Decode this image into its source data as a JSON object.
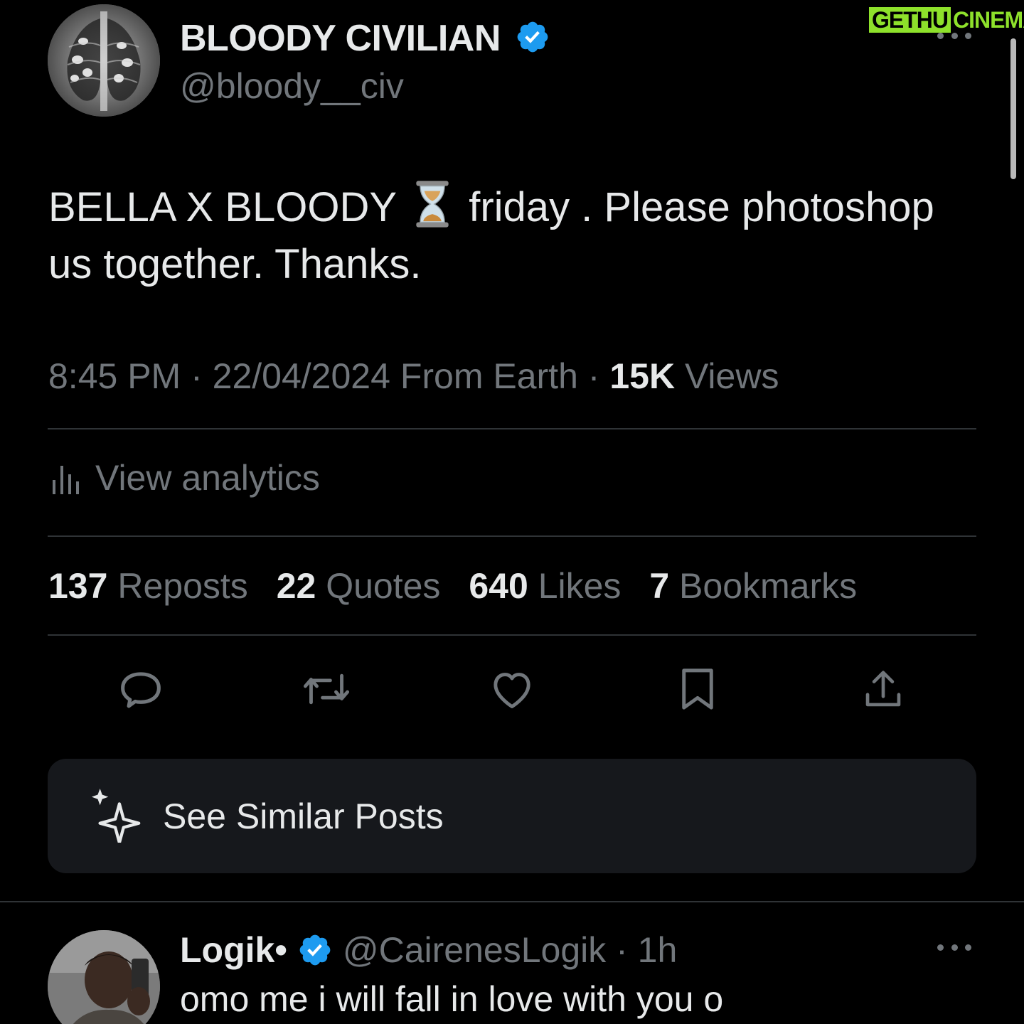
{
  "watermark": {
    "left": "GETHU",
    "right": "CINEMA"
  },
  "post": {
    "author_name": "BLOODY CIVILIAN",
    "author_handle": "@bloody__civ",
    "text_before_emoji": "BELLA X BLOODY",
    "text_after_emoji": "friday . Please photoshop us together. Thanks.",
    "emoji": "hourglass-icon",
    "time": "8:45 PM",
    "date": "22/04/2024",
    "source": "From Earth",
    "views_count": "15K",
    "views_label": "Views",
    "analytics_label": "View analytics",
    "stats": [
      {
        "count": "137",
        "label": "Reposts"
      },
      {
        "count": "22",
        "label": "Quotes"
      },
      {
        "count": "640",
        "label": "Likes"
      },
      {
        "count": "7",
        "label": "Bookmarks"
      }
    ],
    "actions": [
      "reply-icon",
      "repost-icon",
      "like-icon",
      "bookmark-icon",
      "share-icon"
    ],
    "similar_label": "See Similar Posts"
  },
  "reply": {
    "author_name": "Logik•",
    "author_handle": "@CairenesLogik",
    "time": "1h",
    "text": "omo me i will fall in love with you o"
  },
  "colors": {
    "background": "#000000",
    "primary_text": "#e7e9ea",
    "secondary_text": "#71767b",
    "divider": "#2f3336",
    "verified": "#1d9bf0",
    "card": "#16181c",
    "watermark": "#8ee12b"
  }
}
